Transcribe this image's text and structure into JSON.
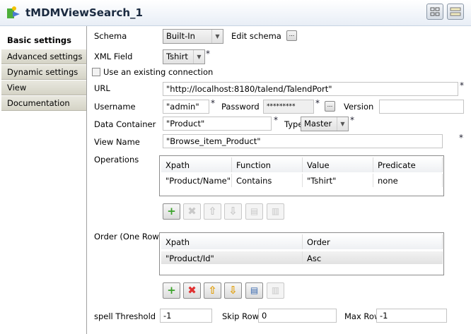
{
  "title": "tMDMViewSearch_1",
  "sidebar": {
    "items": [
      {
        "label": "Basic settings"
      },
      {
        "label": "Advanced settings"
      },
      {
        "label": "Dynamic settings"
      },
      {
        "label": "View"
      },
      {
        "label": "Documentation"
      }
    ]
  },
  "form": {
    "schema_label": "Schema",
    "schema_value": "Built-In",
    "edit_schema_label": "Edit schema",
    "dots": "...",
    "xml_field_label": "XML Field",
    "xml_field_value": "Tshirt",
    "use_existing_label": "Use an existing connection",
    "url_label": "URL",
    "url_value": "\"http://localhost:8180/talend/TalendPort\"",
    "username_label": "Username",
    "username_value": "\"admin\"",
    "password_label": "Password",
    "password_value": "*********",
    "version_label": "Version",
    "version_value": "",
    "data_container_label": "Data Container",
    "data_container_value": "\"Product\"",
    "type_label": "Type",
    "type_value": "Master",
    "view_name_label": "View Name",
    "view_name_value": "\"Browse_item_Product\"",
    "required": "*",
    "operations_label": "Operations",
    "operations": {
      "headers": [
        "Xpath",
        "Function",
        "Value",
        "Predicate"
      ],
      "rows": [
        [
          "\"Product/Name\"",
          "Contains",
          "\"Tshirt\"",
          "none"
        ]
      ]
    },
    "order_label": "Order (One Row)",
    "order": {
      "headers": [
        "Xpath",
        "Order"
      ],
      "rows": [
        [
          "\"Product/Id\"",
          "Asc"
        ]
      ]
    },
    "spell_label": "spell Threshold",
    "spell_value": "-1",
    "skip_label": "Skip Rows",
    "skip_value": "0",
    "max_label": "Max Rows",
    "max_value": "-1"
  },
  "colors": {
    "add": "#3aa32a",
    "remove": "#e03030",
    "move": "#e8b020"
  }
}
